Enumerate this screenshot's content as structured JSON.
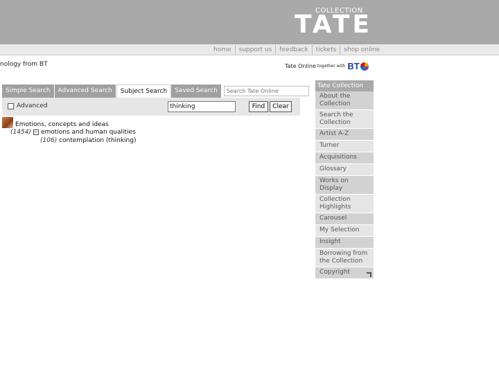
{
  "header": {
    "logo_small": "COLLECTION",
    "logo_large": "TATE"
  },
  "topnav": {
    "home": "home",
    "support": "support us",
    "feedback": "feedback",
    "tickets": "tickets",
    "shop": "shop online"
  },
  "partner": {
    "left_text": "nology from BT",
    "right_text": "Tate Online",
    "together": "together with",
    "bt": "BT"
  },
  "tabs": {
    "simple": "Simple Search",
    "advanced": "Advanced Search",
    "subject": "Subject Search",
    "saved": "Saved Search",
    "site_search_placeholder": "Search Tate Online"
  },
  "search": {
    "advanced_label": "Advanced",
    "query_value": "thinking",
    "find_label": "Find",
    "clear_label": "Clear"
  },
  "results": {
    "category": "Emotions, concepts and ideas",
    "row1_count": "(1454)",
    "row1_label": "emotions and human qualities",
    "row2_count": "(106)",
    "row2_label": "contemplation (thinking)"
  },
  "sidebar": {
    "heading": "Tate Collection",
    "items": [
      {
        "label": "About the Collection"
      },
      {
        "label": "Search the Collection"
      },
      {
        "label": "Artist A-Z"
      },
      {
        "label": "Turner"
      },
      {
        "label": "Acquisitions"
      },
      {
        "label": "Glossary"
      },
      {
        "label": "Works on Display"
      },
      {
        "label": "Collection Highlights"
      },
      {
        "label": "Carousel"
      },
      {
        "label": "My Selection"
      },
      {
        "label": "Insight"
      },
      {
        "label": "Borrowing from the Collection"
      },
      {
        "label": "Copyright"
      }
    ]
  },
  "colors": {
    "header_bg": "#a9a9a9",
    "tab_bg": "#a0a0a0",
    "bt_blue": "#1d3f94"
  }
}
